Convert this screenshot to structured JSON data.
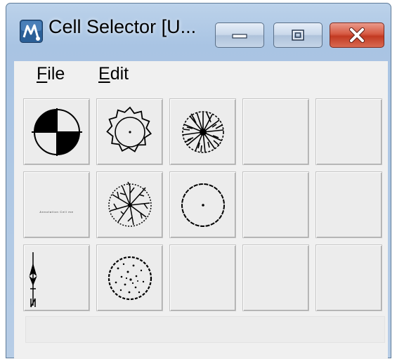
{
  "window": {
    "title": "Cell Selector [U...",
    "icon": "microstation-icon",
    "buttons": {
      "minimize": "minimize-icon",
      "maximize": "maximize-icon",
      "close": "close-icon"
    },
    "colors": {
      "frame": "#a9c4e3",
      "close_button": "#c23a22"
    }
  },
  "menu": {
    "items": [
      {
        "mnemonic": "F",
        "rest": "ile"
      },
      {
        "mnemonic": "E",
        "rest": "dit"
      }
    ]
  },
  "cells": [
    {
      "symbol": "survey-marker"
    },
    {
      "symbol": "sun-star-outline"
    },
    {
      "symbol": "dense-tree-plan"
    },
    {
      "symbol": "empty"
    },
    {
      "symbol": "empty"
    },
    {
      "symbol": "annotation-text",
      "text": "Annotation Cell me"
    },
    {
      "symbol": "branching-tree-plan"
    },
    {
      "symbol": "circle-with-center-dot"
    },
    {
      "symbol": "empty"
    },
    {
      "symbol": "empty"
    },
    {
      "symbol": "north-arrow"
    },
    {
      "symbol": "shrub-plan"
    },
    {
      "symbol": "empty"
    },
    {
      "symbol": "empty"
    },
    {
      "symbol": "empty"
    }
  ],
  "status": {
    "text": ""
  }
}
